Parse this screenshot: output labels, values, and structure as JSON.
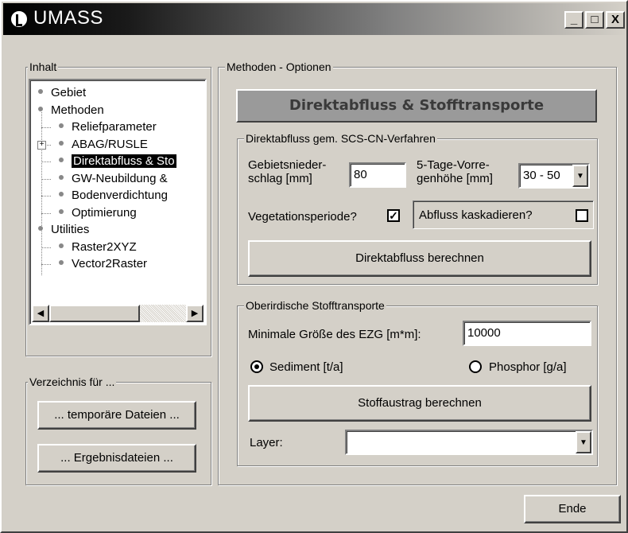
{
  "window": {
    "title": "UMASS",
    "min": "_",
    "max": "□",
    "close": "X"
  },
  "inhalt": {
    "label": "Inhalt",
    "tree": [
      {
        "label": "Gebiet",
        "level": 0
      },
      {
        "label": "Methoden",
        "level": 0
      },
      {
        "label": "Reliefparameter",
        "level": 1
      },
      {
        "label": "ABAG/RUSLE",
        "level": 1,
        "expander": "+"
      },
      {
        "label": "Direktabfluss & Sto",
        "level": 1,
        "selected": true
      },
      {
        "label": "GW-Neubildung &",
        "level": 1
      },
      {
        "label": "Bodenverdichtung",
        "level": 1
      },
      {
        "label": "Optimierung",
        "level": 1
      },
      {
        "label": "Utilities",
        "level": 0
      },
      {
        "label": "Raster2XYZ",
        "level": 1
      },
      {
        "label": "Vector2Raster",
        "level": 1
      }
    ]
  },
  "verzeichnis": {
    "label": "Verzeichnis für ...",
    "temp_button": "... temporäre Dateien ...",
    "result_button": "... Ergebnisdateien ..."
  },
  "methoden": {
    "label": "Methoden - Optionen",
    "header": "Direktabfluss & Stofftransporte",
    "direkt": {
      "label": "Direktabfluss gem. SCS-CN-Verfahren",
      "niederschlag_label1": "Gebietsnieder-",
      "niederschlag_label2": "schlag [mm]",
      "niederschlag_value": "80",
      "vorregen_label1": "5-Tage-Vorre-",
      "vorregen_label2": "genhöhe [mm]",
      "vorregen_value": "30 - 50",
      "vegetation_label": "Vegetationsperiode?",
      "vegetation_checked": "✓",
      "kaskade_label": "Abfluss kaskadieren?",
      "button": "Direktabfluss berechnen"
    },
    "stoff": {
      "label": "Oberirdische Stofftransporte",
      "ezg_label": "Minimale Größe des EZG [m*m]:",
      "ezg_value": "10000",
      "sediment_label": "Sediment [t/a]",
      "phosphor_label": "Phosphor [g/a]",
      "button": "Stoffaustrag berechnen",
      "layer_label": "Layer:",
      "layer_value": ""
    }
  },
  "ende_button": "Ende"
}
